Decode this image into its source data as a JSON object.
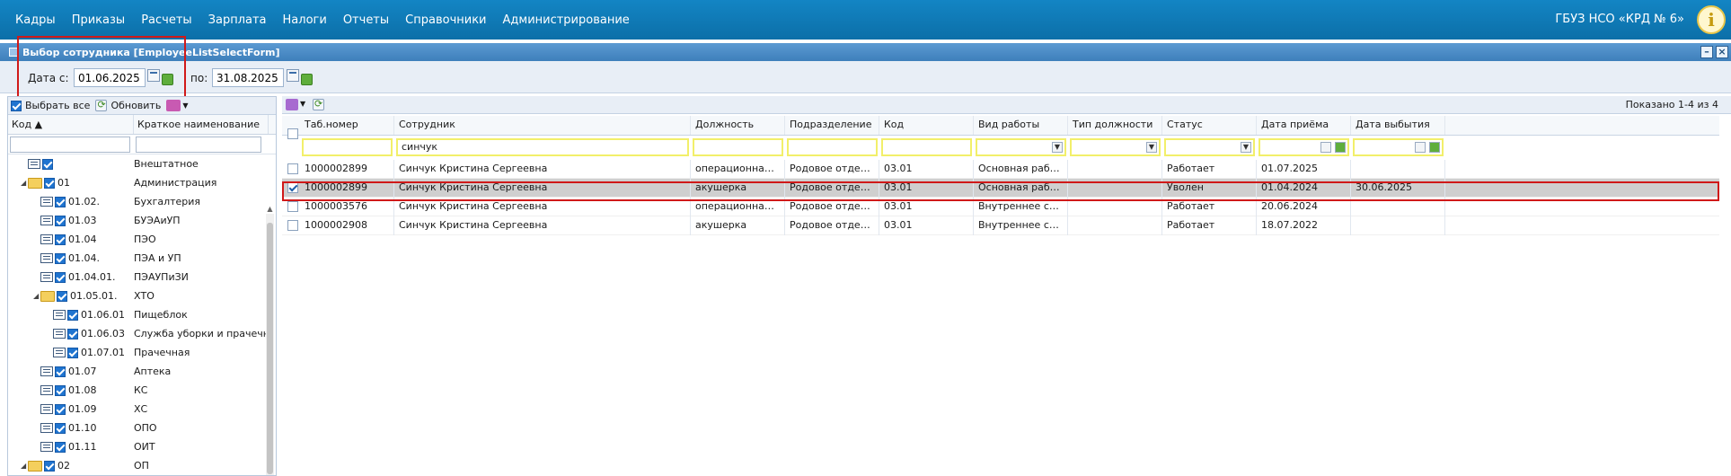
{
  "menu": [
    "Кадры",
    "Приказы",
    "Расчеты",
    "Зарплата",
    "Налоги",
    "Отчеты",
    "Справочники",
    "Администрирование"
  ],
  "org_name": "ГБУЗ НСО «КРД № 6»",
  "window_title": "Выбор сотрудника [EmployeeListSelectForm]",
  "dates": {
    "from_label": "Дата с:",
    "from_value": "01.06.2025",
    "to_label": "по:",
    "to_value": "31.08.2025"
  },
  "left": {
    "select_all": "Выбрать все",
    "refresh": "Обновить",
    "col_code": "Код ▲",
    "col_name": "Краткое наименование",
    "rows": [
      {
        "code": "",
        "name": "Внештатное"
      },
      {
        "code": "01",
        "name": "Администрация"
      },
      {
        "code": "01.02.",
        "name": "Бухгалтерия"
      },
      {
        "code": "01.03",
        "name": "БУЭАиУП"
      },
      {
        "code": "01.04",
        "name": "ПЭО"
      },
      {
        "code": "01.04.",
        "name": "ПЭА и УП"
      },
      {
        "code": "01.04.01.",
        "name": "ПЭАУПиЗИ"
      },
      {
        "code": "01.05.01.",
        "name": "ХТО"
      },
      {
        "code": "01.06.01",
        "name": "Пищеблок"
      },
      {
        "code": "01.06.03",
        "name": "Служба уборки и прачечно"
      },
      {
        "code": "01.07.01",
        "name": "Прачечная"
      },
      {
        "code": "01.07",
        "name": "Аптека"
      },
      {
        "code": "01.08",
        "name": "КС"
      },
      {
        "code": "01.09",
        "name": "ХС"
      },
      {
        "code": "01.10",
        "name": "ОПО"
      },
      {
        "code": "01.11",
        "name": "ОИТ"
      },
      {
        "code": "02",
        "name": "ОП"
      }
    ]
  },
  "right": {
    "shown": "Показано 1-4 из 4",
    "columns": [
      "Таб.номер",
      "Сотрудник",
      "Должность",
      "Подразделение",
      "Код",
      "Вид работы",
      "Тип должности",
      "Статус",
      "Дата приёма",
      "Дата выбытия"
    ],
    "filter_employee": "синчук",
    "rows": [
      [
        "1000002899",
        "Синчук Кристина Сергеевна",
        "операционная медиц...",
        "Родовое отделение",
        "03.01",
        "Основная работа",
        "",
        "Работает",
        "01.07.2025",
        ""
      ],
      [
        "1000002899",
        "Синчук Кристина Сергеевна",
        "акушерка",
        "Родовое отделение",
        "03.01",
        "Основная работа",
        "",
        "Уволен",
        "01.04.2024",
        "30.06.2025"
      ],
      [
        "1000003576",
        "Синчук Кристина Сергеевна",
        "операционная медиц...",
        "Родовое отделение",
        "03.01",
        "Внутреннее совмести...",
        "",
        "Работает",
        "20.06.2024",
        ""
      ],
      [
        "1000002908",
        "Синчук Кристина Сергеевна",
        "акушерка",
        "Родовое отделение",
        "03.01",
        "Внутреннее совмести...",
        "",
        "Работает",
        "18.07.2022",
        ""
      ]
    ]
  },
  "colors": {
    "menu_bg": "#0c6fa8",
    "title_bg": "#3e7fbb",
    "selected_row": "#cfcfcf",
    "highlight": "#d01919",
    "filter_border": "#f2ef6a"
  }
}
